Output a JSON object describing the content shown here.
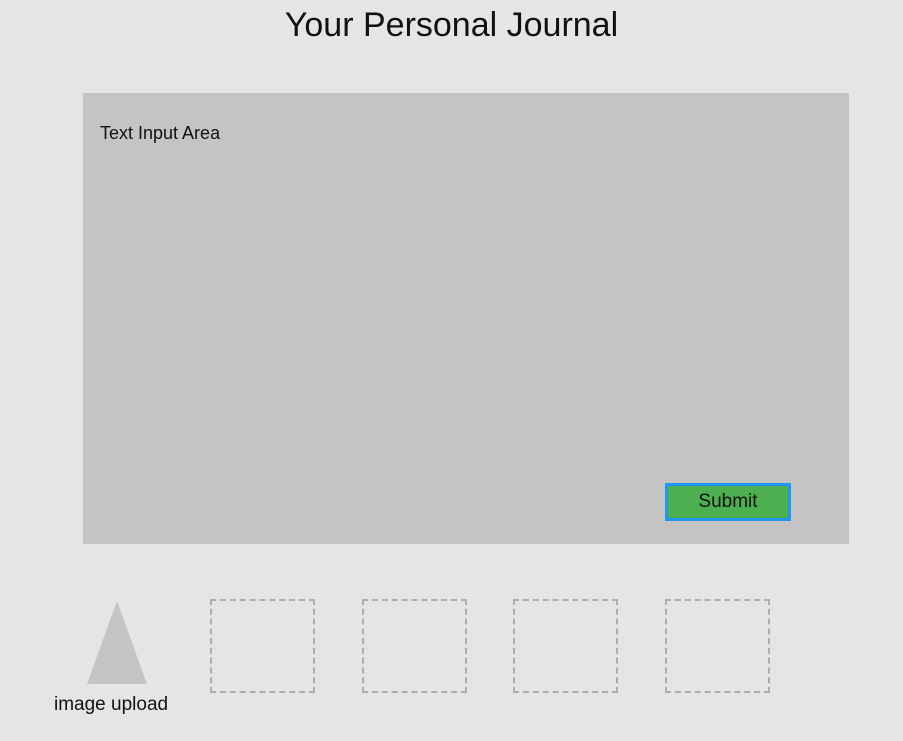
{
  "header": {
    "title": "Your Personal Journal"
  },
  "journal": {
    "text_area_label": "Text Input Area",
    "submit_label": "Submit"
  },
  "upload": {
    "label": "image upload",
    "icon": "triangle-upload-icon"
  },
  "image_slots": [
    {
      "state": "empty"
    },
    {
      "state": "empty"
    },
    {
      "state": "empty"
    },
    {
      "state": "empty"
    }
  ],
  "colors": {
    "background": "#e5e5e5",
    "panel": "#c4c4c4",
    "submit_fill": "#4caf50",
    "submit_border": "#2196f3",
    "slot_border": "#adadad"
  }
}
